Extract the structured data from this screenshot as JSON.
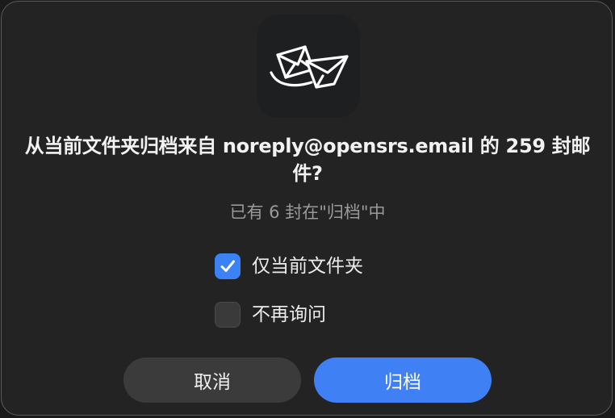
{
  "dialog": {
    "title": "从当前文件夹归档来自 noreply@opensrs.email 的 259 封邮件?",
    "subtitle": "已有 6 封在\"归档\"中",
    "icon": "mail-archive-icon"
  },
  "options": {
    "current_folder_only": {
      "label": "仅当前文件夹",
      "checked": true
    },
    "dont_ask_again": {
      "label": "不再询问",
      "checked": false
    }
  },
  "buttons": {
    "cancel_label": "取消",
    "archive_label": "归档"
  },
  "colors": {
    "accent": "#3f80f4",
    "background": "#232323"
  }
}
